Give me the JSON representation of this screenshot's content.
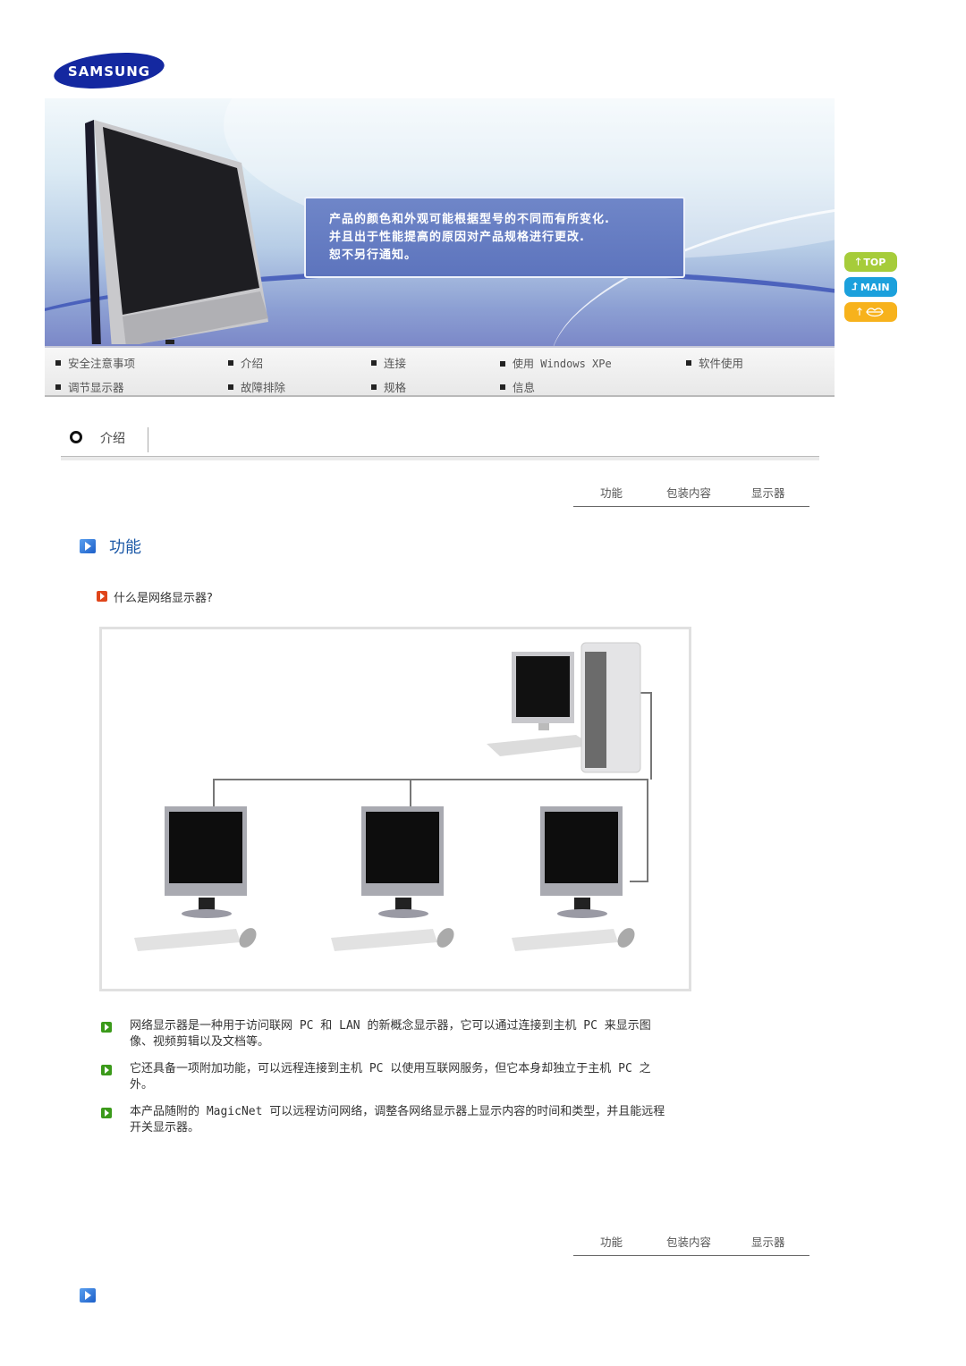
{
  "brand": {
    "logo_text": "SAMSUNG"
  },
  "banner": {
    "notice_lines": [
      "产品的颜色和外观可能根据型号的不同而有所变化.",
      "并且出于性能提高的原因对产品规格进行更改.",
      "恕不另行通知。"
    ]
  },
  "side_buttons": {
    "top": "TOP",
    "main": "MAIN",
    "lang": ""
  },
  "nav": {
    "items": [
      {
        "label": "安全注意事项"
      },
      {
        "label": "介绍"
      },
      {
        "label": "连接"
      },
      {
        "label": "使用 Windows XPe"
      },
      {
        "label": "软件使用"
      },
      {
        "label": "调节显示器"
      },
      {
        "label": "故障排除"
      },
      {
        "label": "规格"
      },
      {
        "label": "信息"
      }
    ]
  },
  "section": {
    "title": "介绍"
  },
  "subtabs": {
    "items": [
      "功能",
      "包装内容",
      "显示器"
    ]
  },
  "content": {
    "heading": "功能",
    "question": "什么是网络显示器?",
    "bullets": [
      {
        "line1": "网络显示器是一种用于访问联网 PC 和 LAN 的新概念显示器，它可以通过连接到主机 PC 来显示图",
        "line2": "像、视频剪辑以及文档等。"
      },
      {
        "line1": "它还具备一项附加功能，可以远程连接到主机 PC 以使用互联网服务，但它本身却独立于主机 PC 之",
        "line2": "外。"
      },
      {
        "line1": "本产品随附的 MagicNet 可以远程访问网络，调整各网络显示器上显示内容的时间和类型，并且能远程",
        "line2": "开关显示器。"
      }
    ]
  },
  "colors": {
    "heading_blue": "#1e5aa8",
    "bullet_green": "#3b9a1a",
    "question_red": "#e0451a"
  }
}
